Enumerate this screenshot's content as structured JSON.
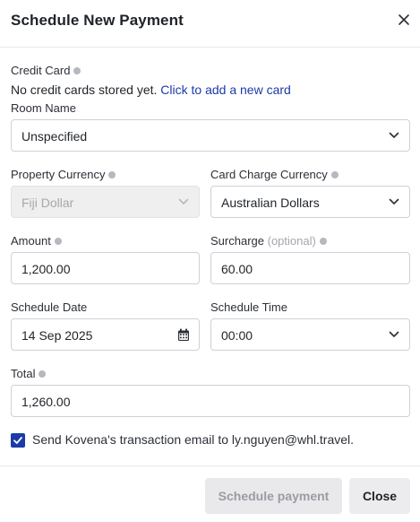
{
  "dialog": {
    "title": "Schedule New Payment"
  },
  "credit_card": {
    "label": "Credit Card",
    "empty_text": "No credit cards stored yet.",
    "add_link": "Click to add a new card"
  },
  "room_name": {
    "label": "Room Name",
    "value": "Unspecified"
  },
  "property_currency": {
    "label": "Property Currency",
    "value": "Fiji Dollar",
    "disabled": true
  },
  "card_charge_currency": {
    "label": "Card Charge Currency",
    "value": "Australian Dollars"
  },
  "amount": {
    "label": "Amount",
    "value": "1,200.00"
  },
  "surcharge": {
    "label": "Surcharge",
    "optional_hint": "(optional)",
    "value": "60.00"
  },
  "schedule_date": {
    "label": "Schedule Date",
    "value": "14 Sep 2025"
  },
  "schedule_time": {
    "label": "Schedule Time",
    "value": "00:00"
  },
  "total": {
    "label": "Total",
    "value": "1,260.00"
  },
  "send_email": {
    "checked": true,
    "label": "Send Kovena's transaction email to ly.nguyen@whl.travel."
  },
  "footer": {
    "schedule_button": "Schedule payment",
    "close_button": "Close"
  },
  "colors": {
    "accent": "#1c3aa9",
    "disabled_bg": "#efefef"
  },
  "icons": [
    "close-icon",
    "info-icon",
    "chevron-down-icon",
    "calendar-icon",
    "checkmark-icon"
  ]
}
